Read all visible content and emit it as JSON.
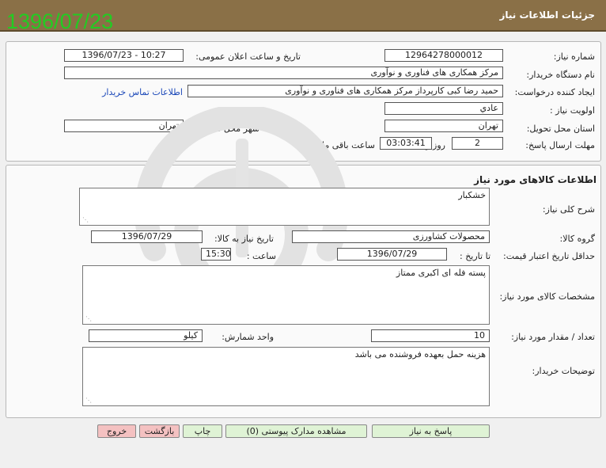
{
  "header": {
    "title": "جزئیات اطلاعات نیاز",
    "overlay_date": "1396/07/23"
  },
  "need_info": {
    "need_number_label": "شماره نیاز:",
    "need_number": "12964278000012",
    "announce_label": "تاریخ و ساعت اعلان عمومی:",
    "announce_value": "1396/07/23 - 10:27",
    "buyer_org_label": "نام دستگاه خریدار:",
    "buyer_org": "مرکز همکاری های فناوری و نوآوری",
    "requester_label": "ایجاد کننده درخواست:",
    "requester": "حمید رضا کبی کارپرداز مرکز همکاری های فناوری و نوآوری",
    "contact_link": "اطلاعات تماس خریدار",
    "priority_label": "اولویت نیاز :",
    "priority": "عادي",
    "province_label": "استان محل تحویل:",
    "province": "تهران",
    "city_label": "شهر محل تحویل:",
    "city": "تهران",
    "deadline_label": "مهلت ارسال پاسخ:",
    "days": "2",
    "days_unit": "روز و",
    "time_left": "03:03:41",
    "remaining_label": "ساعت باقی مانده"
  },
  "goods": {
    "section_title": "اطلاعات کالاهای مورد نیاز",
    "general_desc_label": "شرح کلی نیاز:",
    "general_desc": "خشکبار",
    "group_label": "گروه کالا:",
    "group": "محصولات کشاورزی",
    "need_date_label": "تاریخ نیاز به کالا:",
    "need_date": "1396/07/29",
    "price_validity_label": "حداقل تاریخ اعتبار قیمت:",
    "until_label": "تا تاریخ :",
    "price_validity_date": "1396/07/29",
    "time_label": "ساعت :",
    "price_validity_time": "15:30",
    "specs_label": "مشخصات کالای مورد نیاز:",
    "specs": "پسته فله ای  اکبری ممتاز",
    "quantity_label": "تعداد / مقدار مورد نیاز:",
    "quantity": "10",
    "unit_label": "واحد شمارش:",
    "unit": "کیلو",
    "buyer_notes_label": "توضیحات خریدار:",
    "buyer_notes": "هزینه  حمل بعهده فروشنده می باشد"
  },
  "buttons": {
    "reply": "پاسخ به نیاز",
    "attachments": "مشاهده مدارک پیوستی (0)",
    "print": "چاپ",
    "back": "بازگشت",
    "exit": "خروج"
  },
  "colors": {
    "header_bg": "#8a7047",
    "overlay_green": "#22cc22",
    "link_blue": "#1a47b8",
    "btn_green": "#dff3d5",
    "btn_red": "#f4c1c1"
  }
}
